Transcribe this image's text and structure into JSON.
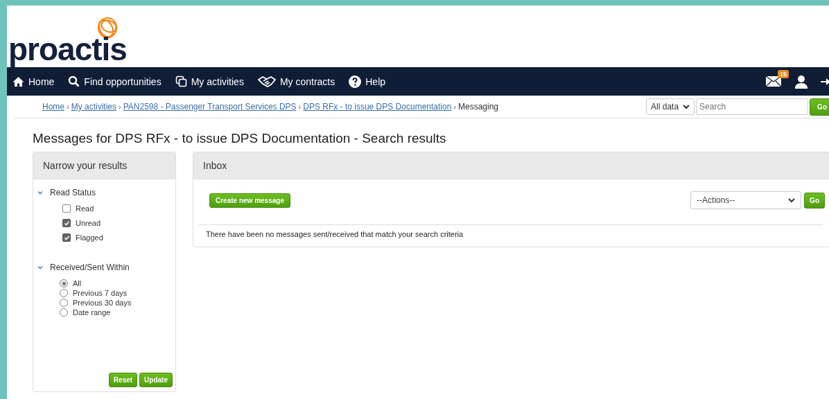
{
  "logo": {
    "text": "proactis"
  },
  "nav": {
    "items": [
      {
        "label": "Home",
        "kind": "home"
      },
      {
        "label": "Find opportunities",
        "kind": "search"
      },
      {
        "label": "My activities",
        "kind": "copy"
      },
      {
        "label": "My contracts",
        "kind": "handshake"
      },
      {
        "label": "Help",
        "kind": "help"
      }
    ],
    "mail_badge": "15"
  },
  "breadcrumb": [
    {
      "label": "Home",
      "link": true
    },
    {
      "separator": "›",
      "label": "My activities",
      "link": true
    },
    {
      "separator": "›",
      "label": "PAN2598 - Passenger Transport Services DPS",
      "link": true
    },
    {
      "separator": "›",
      "label": "DPS RFx - to issue DPS Documentation",
      "link": true
    },
    {
      "separator": "›",
      "label": "Messaging",
      "link": false
    }
  ],
  "search": {
    "scope": "All data",
    "placeholder": "Search",
    "button": "Go"
  },
  "heading": "Messages for DPS RFx - to issue DPS Documentation - Search results",
  "filter_panel": {
    "title": "Narrow your results",
    "groups": [
      {
        "title": "Read Status",
        "expanded": true,
        "kind": "checkbox",
        "options": [
          {
            "label": "Read",
            "checked": false
          },
          {
            "label": "Unread",
            "checked": true
          },
          {
            "label": "Flagged",
            "checked": true
          }
        ]
      },
      {
        "title": "Received/Sent Within",
        "expanded": true,
        "kind": "radio",
        "options": [
          {
            "label": "All",
            "selected": true
          },
          {
            "label": "Previous 7 days",
            "selected": false
          },
          {
            "label": "Previous 30 days",
            "selected": false
          },
          {
            "label": "Date range",
            "selected": false
          }
        ]
      }
    ],
    "buttons": [
      "Reset",
      "Update"
    ]
  },
  "inbox": {
    "title": "Inbox",
    "create_button": "Create new message",
    "actions": "--Actions--",
    "go_button": "Go",
    "empty_message": "There have been no messages sent/received that match your search criteria"
  }
}
